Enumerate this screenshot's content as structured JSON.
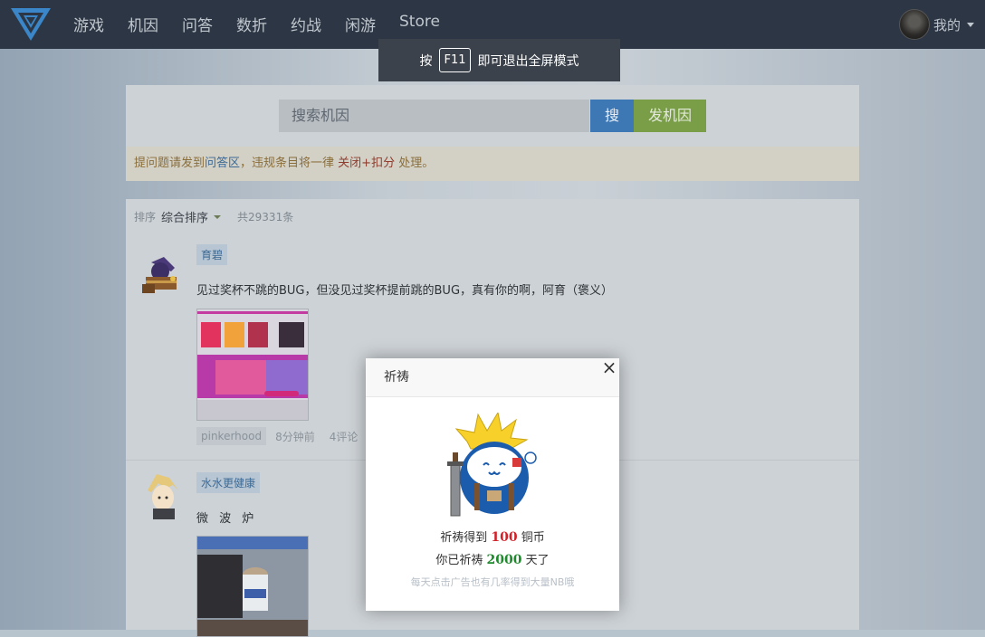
{
  "nav": {
    "logo": "V-logo",
    "items": [
      "游戏",
      "机因",
      "问答",
      "数折",
      "约战",
      "闲游",
      "Store"
    ],
    "user_label": "我的"
  },
  "fullscreen_banner": {
    "prefix": "按",
    "key": "F11",
    "suffix": "即可退出全屏模式"
  },
  "search": {
    "placeholder": "搜索机因",
    "search_button": "搜",
    "post_button": "发机因"
  },
  "notice": {
    "part1": "提问题请发到",
    "link": "问答区",
    "part2": "，违规条目将一律 ",
    "penalty": "关闭+扣分",
    "part3": " 处理。"
  },
  "list": {
    "sort_label": "排序",
    "sort_value": "综合排序",
    "total": "共29331条",
    "posts": [
      {
        "tag": "育碧",
        "text": "见过奖杯不跳的BUG，但没见过奖杯提前跳的BUG，真有你的啊，阿育（褒义）",
        "username": "pinkerhood",
        "time": "8分钟前",
        "comments": "4评论"
      },
      {
        "tag": "水水更健康",
        "text": "微 波 炉"
      }
    ]
  },
  "modal": {
    "title": "祈祷",
    "line1_prefix": "祈祷得到",
    "line1_amount": "100",
    "line1_suffix": "铜币",
    "line2_prefix": "你已祈祷",
    "line2_days": "2000",
    "line2_suffix": "天了",
    "hint": "每天点击广告也有几率得到大量NB哦",
    "close": "×"
  },
  "colors": {
    "nav_bg": "#2c3644",
    "search_btn": "#3d78b5",
    "post_btn": "#7a9e47",
    "amount_red": "#d0222a",
    "days_green": "#1d8a2c"
  }
}
